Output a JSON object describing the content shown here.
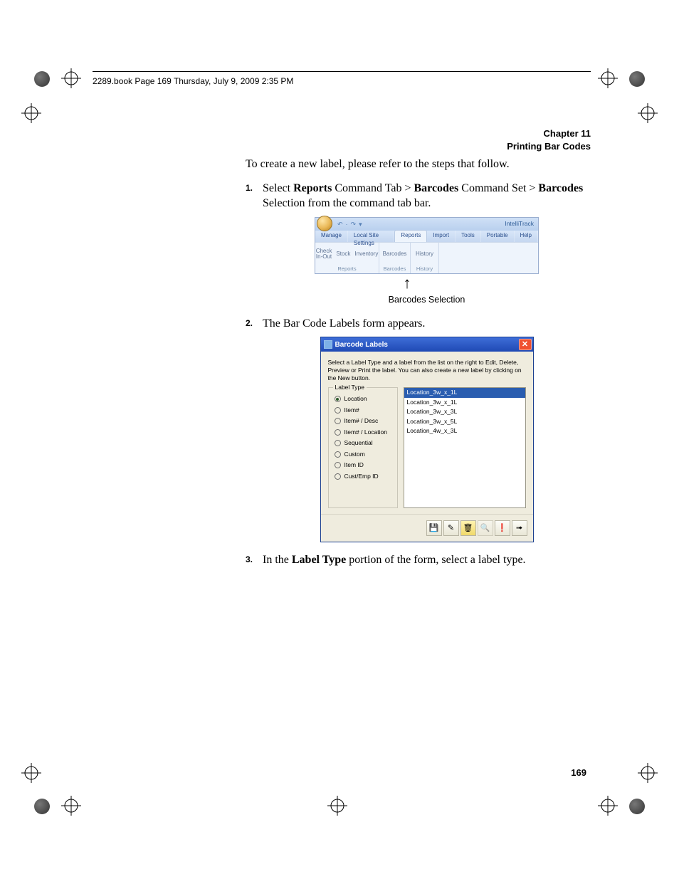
{
  "book_header": "2289.book  Page 169  Thursday, July 9, 2009  2:35 PM",
  "chapter": {
    "line1": "Chapter 11",
    "line2": "Printing Bar Codes"
  },
  "intro": "To create a new label, please refer to the steps that follow.",
  "steps": {
    "s1_pre": "Select ",
    "s1_b1": "Reports",
    "s1_mid1": " Command Tab > ",
    "s1_b2": "Barcodes",
    "s1_mid2": " Command Set > ",
    "s1_b3": "Barcodes",
    "s1_post": " Selection from the command tab bar.",
    "s2": "The Bar Code Labels form appears.",
    "s3_pre": "In the ",
    "s3_b1": "Label Type",
    "s3_post": " portion of the form, select a label type."
  },
  "figure1": {
    "caption": "Barcodes Selection",
    "app_name": "IntelliTrack",
    "tabs": [
      "Manage",
      "Local Site Settings",
      "Reports",
      "Import",
      "Tools",
      "Portable",
      "Help"
    ],
    "group1_label": "Reports",
    "group1_items": [
      "Check In-Out",
      "Stock",
      "Inventory"
    ],
    "group2_label": "Barcodes",
    "group2_items": [
      "Barcodes"
    ],
    "group3_label": "History",
    "group3_items": [
      "History"
    ]
  },
  "figure2": {
    "title": "Barcode Labels",
    "instruction": "Select a Label Type and a label from the list on the right to Edit, Delete, Preview or Print the label. You can also create a new label by clicking on the New button.",
    "fieldset_legend": "Label Type",
    "radios": [
      "Location",
      "Item#",
      "Item# / Desc",
      "Item# / Location",
      "Sequential",
      "Custom",
      "Item ID",
      "Cust/Emp ID"
    ],
    "selected_radio": 0,
    "list": [
      "Location_3w_x_1L",
      "Location_3w_x_1L",
      "Location_3w_x_3L",
      "Location_3w_x_5L",
      "Location_4w_x_3L"
    ],
    "btn_save": "💾",
    "btn_new": "✎",
    "btn_delete": "🗑",
    "btn_preview": "🔍",
    "btn_print": "❗",
    "btn_exit": "➟"
  },
  "page_number": "169"
}
